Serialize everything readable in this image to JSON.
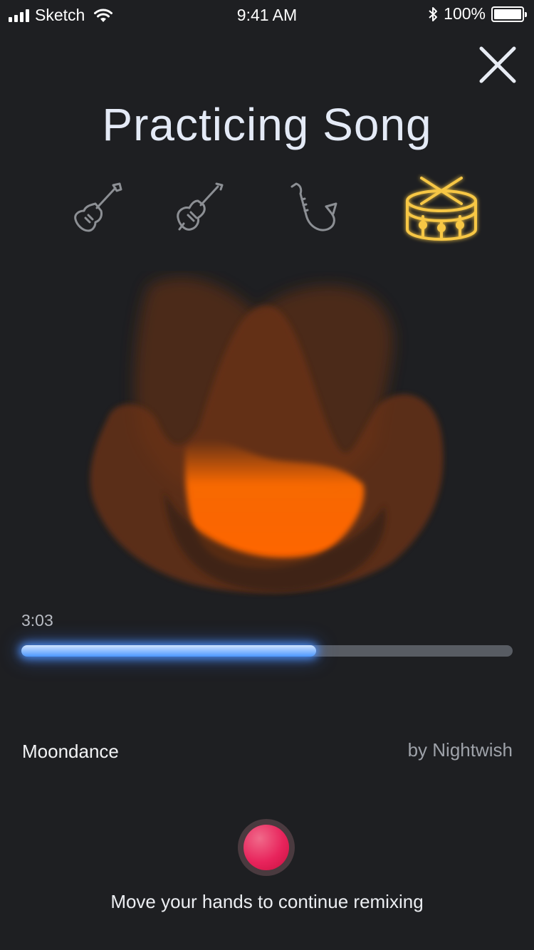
{
  "status_bar": {
    "carrier": "Sketch",
    "time": "9:41 AM",
    "battery": "100%"
  },
  "header": {
    "title": "Practicing Song"
  },
  "instruments": [
    {
      "name": "electric-guitar",
      "icon": "guitar-icon",
      "selected": false
    },
    {
      "name": "violin",
      "icon": "violin-icon",
      "selected": false
    },
    {
      "name": "saxophone",
      "icon": "saxophone-icon",
      "selected": false
    },
    {
      "name": "drum",
      "icon": "drum-icon",
      "selected": true
    }
  ],
  "colors": {
    "background": "#1e1f22",
    "accent_selected": "#f7c744",
    "inactive_icon": "#8c8f94",
    "progress": "#4d98ff",
    "record": "#e8245c",
    "visualizer": "#ff6a00"
  },
  "player": {
    "elapsed": "3:03",
    "progress": 0.6
  },
  "song": {
    "title": "Moondance",
    "artist": "by Nightwish"
  },
  "footer": {
    "hint": "Move your hands to continue remixing"
  }
}
